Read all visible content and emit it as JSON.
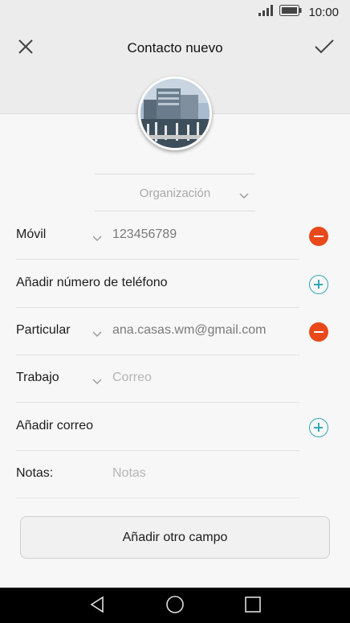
{
  "status_bar": {
    "time": "10:00",
    "signal_icon": "signal-icon",
    "battery_icon": "battery-icon"
  },
  "header": {
    "title": "Contacto nuevo",
    "close_icon": "close-icon",
    "confirm_icon": "check-icon"
  },
  "avatar": {
    "description_icon": "contact-photo"
  },
  "organization": {
    "placeholder": "Organización"
  },
  "rows": [
    {
      "label": "Móvil",
      "value": "123456789",
      "has_dropdown": true,
      "action": "remove"
    },
    {
      "label": "Añadir número de teléfono",
      "value": "",
      "has_dropdown": false,
      "action": "add"
    },
    {
      "label": "Particular",
      "value": "ana.casas.wm@gmail.com",
      "has_dropdown": true,
      "action": "remove"
    },
    {
      "label": "Trabajo",
      "value": "Correo",
      "has_dropdown": true,
      "action": "none"
    },
    {
      "label": "Añadir correo",
      "value": "",
      "has_dropdown": false,
      "action": "add"
    },
    {
      "label": "Notas:",
      "value": "Notas",
      "has_dropdown": false,
      "action": "none"
    }
  ],
  "add_field_button": "Añadir otro campo",
  "colors": {
    "remove": "#e8481a",
    "add": "#32a8b8",
    "header_bg": "#ececec",
    "page_bg": "#f7f7f7"
  },
  "nav": {
    "back_icon": "back-triangle-icon",
    "home_icon": "home-circle-icon",
    "recents_icon": "recents-square-icon"
  }
}
